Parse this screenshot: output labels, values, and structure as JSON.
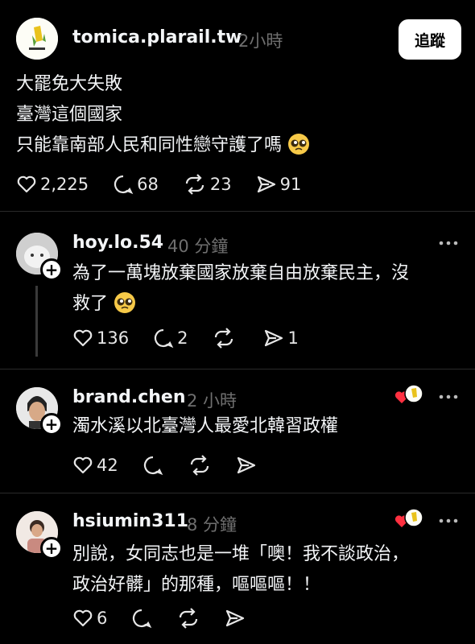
{
  "main_post": {
    "username": "tomica.plarail.tw",
    "time": "2小時",
    "follow_label": "追蹤",
    "lines": [
      "大罷免大失敗",
      "臺灣這個國家",
      "只能靠南部人民和同性戀守護了嗎"
    ],
    "likes": "2,225",
    "comments": "68",
    "reposts": "23",
    "shares": "91"
  },
  "replies": [
    {
      "username": "hoy.lo.54",
      "time": "40 分鐘",
      "lines": [
        "為了一萬塊放棄國家放棄自由放棄民主，沒",
        "救了"
      ],
      "likes": "136",
      "comments": "2",
      "reposts": "",
      "shares": "1"
    },
    {
      "username": "brand.chen",
      "time": "2 小時",
      "lines": [
        "濁水溪以北臺灣人最愛北韓習政權"
      ],
      "likes": "42",
      "comments": "",
      "reposts": "",
      "shares": ""
    },
    {
      "username": "hsiumin311",
      "time": "8 分鐘",
      "lines": [
        "別說，女同志也是一堆「噢！我不談政治，",
        "政治好髒」的那種，嘔嘔嘔！！"
      ],
      "likes": "6",
      "comments": "",
      "reposts": "",
      "shares": ""
    }
  ],
  "colors": {
    "background": "#000000",
    "text": "#f3f5f7",
    "muted": "#6f6f6f",
    "like_red": "#ff3040"
  },
  "icons": [
    "heart-icon",
    "comment-icon",
    "repost-icon",
    "share-icon",
    "more-icon",
    "plus-icon",
    "pleading-face-emoji"
  ]
}
